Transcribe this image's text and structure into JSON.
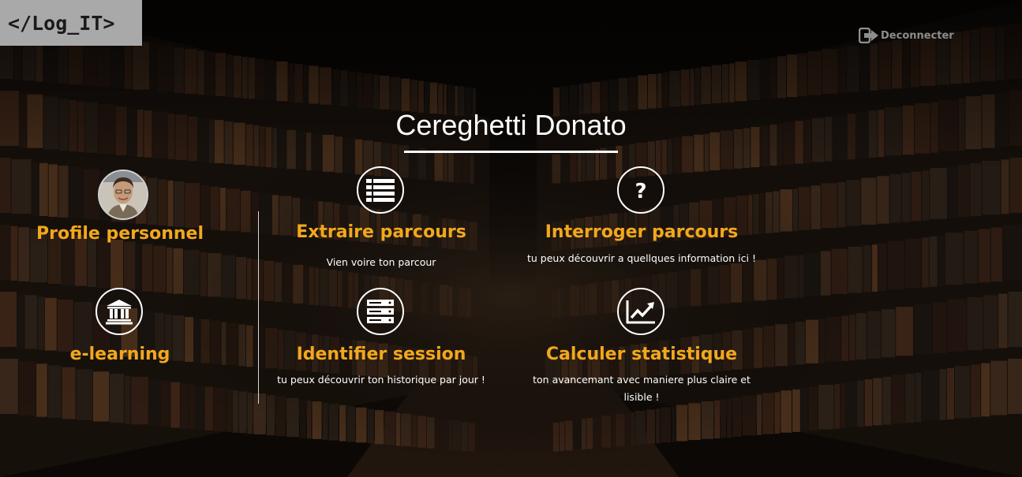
{
  "app": {
    "logo_text": "</Log_IT>",
    "logout_label": "Deconnecter",
    "user_name": "Cereghetti Donato"
  },
  "colors": {
    "accent": "#f2a81c",
    "text": "#ffffff",
    "logo_bg": "#a9a9a9"
  },
  "left_menu": [
    {
      "title": "Profile personnel",
      "icon": "avatar-photo"
    },
    {
      "title": "e-learning",
      "icon": "university-icon"
    }
  ],
  "features": [
    {
      "title": "Extraire parcours",
      "description": "Vien voire ton parcour",
      "icon": "list-icon"
    },
    {
      "title": "Interroger parcours",
      "description": "tu peux découvrir a quellques information ici !",
      "icon": "question-icon"
    },
    {
      "title": "Identifier session",
      "description": "tu peux découvrir ton historique par jour !",
      "icon": "server-icon"
    },
    {
      "title": "Calculer statistique",
      "description": "ton avancemant avec maniere plus claire et lisible !",
      "icon": "chart-line-icon"
    }
  ]
}
